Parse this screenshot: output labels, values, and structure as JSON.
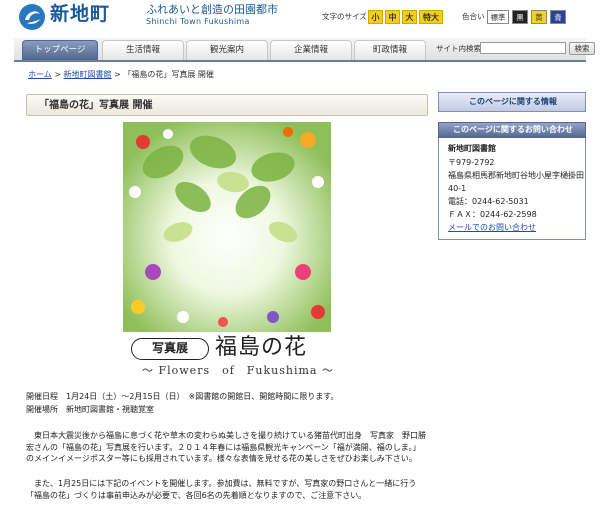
{
  "header": {
    "site_name": "新地町",
    "tagline": "ふれあいと創造の田園都市",
    "tagline_en": "Shinchi Town Fukushima",
    "font_size_label": "文字のサイズ",
    "font_sizes": [
      "小",
      "中",
      "大",
      "特大"
    ],
    "color_label": "色合い",
    "colors": [
      {
        "label": "標準",
        "bg": "#ffffff",
        "fg": "#333333"
      },
      {
        "label": "黒",
        "bg": "#222222",
        "fg": "#ffffff"
      },
      {
        "label": "黄",
        "bg": "#f2d41c",
        "fg": "#333333"
      },
      {
        "label": "青",
        "bg": "#2b3f9c",
        "fg": "#ffffff"
      }
    ]
  },
  "nav": {
    "tabs": [
      "トップページ",
      "生活情報",
      "観光案内",
      "企業情報",
      "町政情報"
    ],
    "active_index": 0,
    "search_label": "サイト内検索",
    "search_value": "",
    "search_button": "検索"
  },
  "breadcrumb": {
    "items": [
      "ホーム",
      "新地町図書館"
    ],
    "current": "「福島の花」写真展 開催",
    "separator": ">"
  },
  "main": {
    "title": "「福島の花」写真展 開催",
    "poster_badge": "写真展",
    "poster_title": "福島の花",
    "poster_subtitle": "～ Flowers　of　Fukushima ～",
    "schedule": "開催日程　1月24日（土）～2月15日（日）　※図書館の開館日、開館時間に限ります。",
    "venue": "開催場所　新地町図書館・視聴覚室",
    "paragraph1": "　東日本大震災後から福島に息づく花や草木の変わらぬ美しさを撮り続けている猪苗代町出身　写真家　野口勝宏さんの「福島の花」写真展を行います。２０１４年春には福島県観光キャンペーン「福が満開、福のしま。」のメインイメージポスター等にも採用されています。様々な表情を見せる花の美しさをぜひお楽しみ下さい。",
    "paragraph2": "　また、1月25日には下記のイベントを開催します。参加費は、無料ですが、写真家の野口さんと一緒に行う「福島の花」づくりは事前申込みが必要で、各回6名の先着順となりますので、ご注意下さい。"
  },
  "sidebar": {
    "page_info_title": "このページに関する情報",
    "contact_title": "このページに関するお問い合わせ",
    "contact": {
      "name": "新地町図書館",
      "postal": "〒979-2792",
      "address1": "福島県相馬郡新地町谷地小屋字樋掛田",
      "address2": "40-1",
      "tel": "電話：0244-62-5031",
      "fax": "ＦＡＸ：0244-62-2598",
      "mail_link": "メールでのお問い合わせ"
    }
  }
}
